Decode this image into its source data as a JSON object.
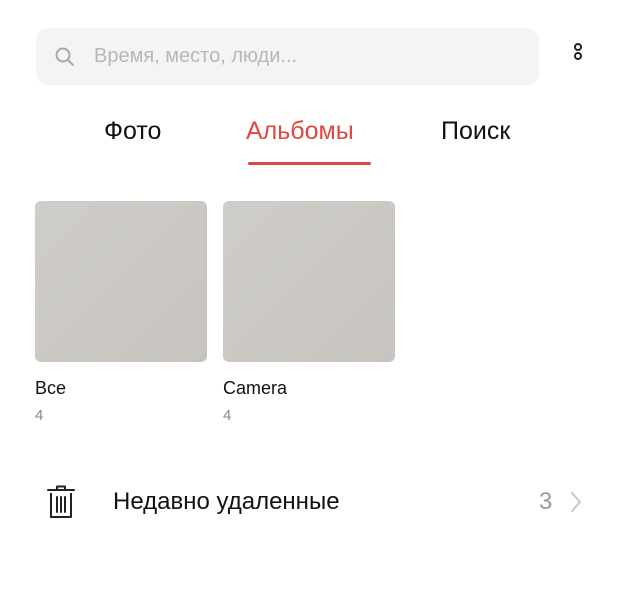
{
  "search": {
    "placeholder": "Время, место, люди..."
  },
  "tabs": [
    {
      "label": "Фото",
      "active": false
    },
    {
      "label": "Альбомы",
      "active": true
    },
    {
      "label": "Поиск",
      "active": false
    }
  ],
  "albums": [
    {
      "name": "Все",
      "count": "4"
    },
    {
      "name": "Camera",
      "count": "4"
    }
  ],
  "recently_deleted": {
    "label": "Недавно удаленные",
    "count": "3"
  },
  "colors": {
    "accent": "#e2473f",
    "search_background": "#f4f4f4",
    "secondary_text": "#8a8a8a"
  },
  "icons": {
    "search": "search-icon",
    "more": "more-vertical-icon",
    "trash": "trash-icon",
    "chevron": "chevron-right-icon"
  }
}
